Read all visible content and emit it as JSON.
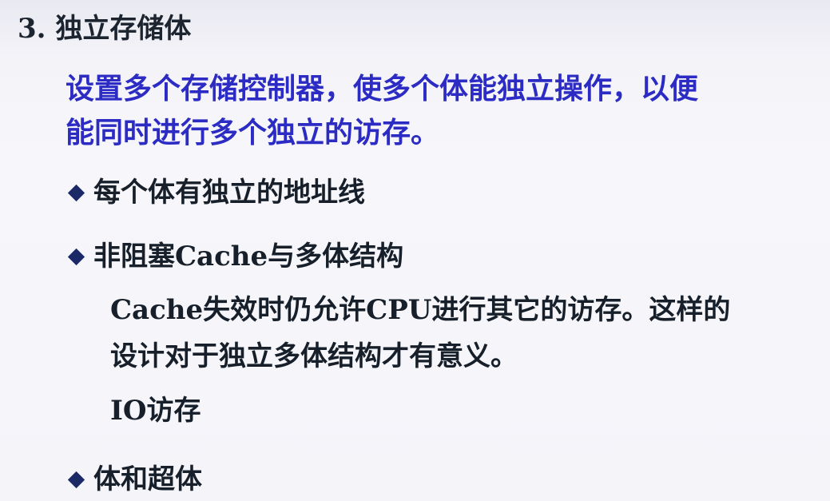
{
  "slide": {
    "title": "3. 独立存储体",
    "intro_lines": [
      "设置多个存储控制器，使多个体能独立操作，以便",
      "能同时进行多个独立的访存。"
    ],
    "bullets": [
      {
        "icon": "diamond-bullet-icon",
        "text": "每个体有独立的地址线"
      },
      {
        "icon": "diamond-bullet-icon",
        "text": "非阻塞Cache与多体结构",
        "details": [
          "Cache失效时仍允许CPU进行其它的访存。这样的",
          "设计对于独立多体结构才有意义。",
          "IO访存"
        ]
      },
      {
        "icon": "diamond-bullet-icon",
        "text": "体和超体"
      }
    ],
    "colors": {
      "title": "#1c2430",
      "intro": "#2c2cc4",
      "body": "#17202a",
      "bullet": "#1b2a66",
      "background": "#f4f4f9"
    }
  }
}
